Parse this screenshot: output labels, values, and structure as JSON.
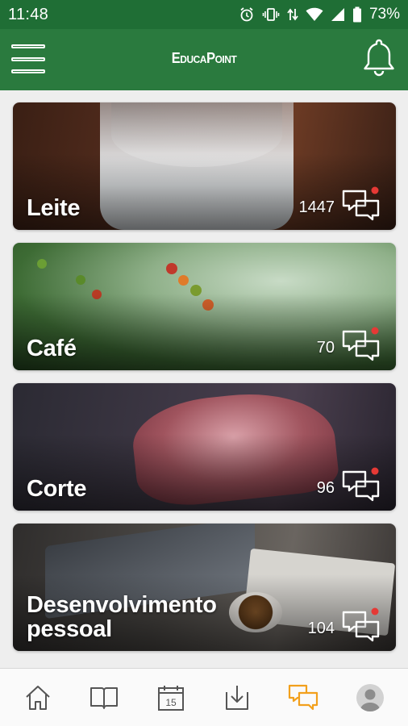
{
  "status_bar": {
    "time": "11:48",
    "battery": "73%",
    "icons": [
      "alarm-icon",
      "vibrate-icon",
      "data-arrows-icon",
      "wifi-icon",
      "signal-icon",
      "battery-icon"
    ]
  },
  "app_bar": {
    "brand": "EducaPoint",
    "menu_icon": "hamburger-menu-icon",
    "notification_icon": "bell-icon"
  },
  "colors": {
    "primary_green": "#2a7a3e",
    "status_green": "#1f6e35",
    "active_nav": "#f2a01c",
    "badge_red": "#e53935"
  },
  "cards": [
    {
      "title": "Leite",
      "count": "1447",
      "icon": "chat-bubbles-icon"
    },
    {
      "title": "Café",
      "count": "70",
      "icon": "chat-bubbles-icon"
    },
    {
      "title": "Corte",
      "count": "96",
      "icon": "chat-bubbles-icon"
    },
    {
      "title": "Desenvolvimento pessoal",
      "count": "104",
      "icon": "chat-bubbles-icon"
    }
  ],
  "bottom_nav": {
    "items": [
      {
        "icon": "home-icon",
        "active": false
      },
      {
        "icon": "book-icon",
        "active": false
      },
      {
        "icon": "calendar-icon",
        "calendar_day": "15",
        "active": false
      },
      {
        "icon": "download-icon",
        "active": false
      },
      {
        "icon": "chat-bubbles-icon",
        "active": true
      },
      {
        "icon": "profile-avatar-icon",
        "active": false
      }
    ]
  }
}
